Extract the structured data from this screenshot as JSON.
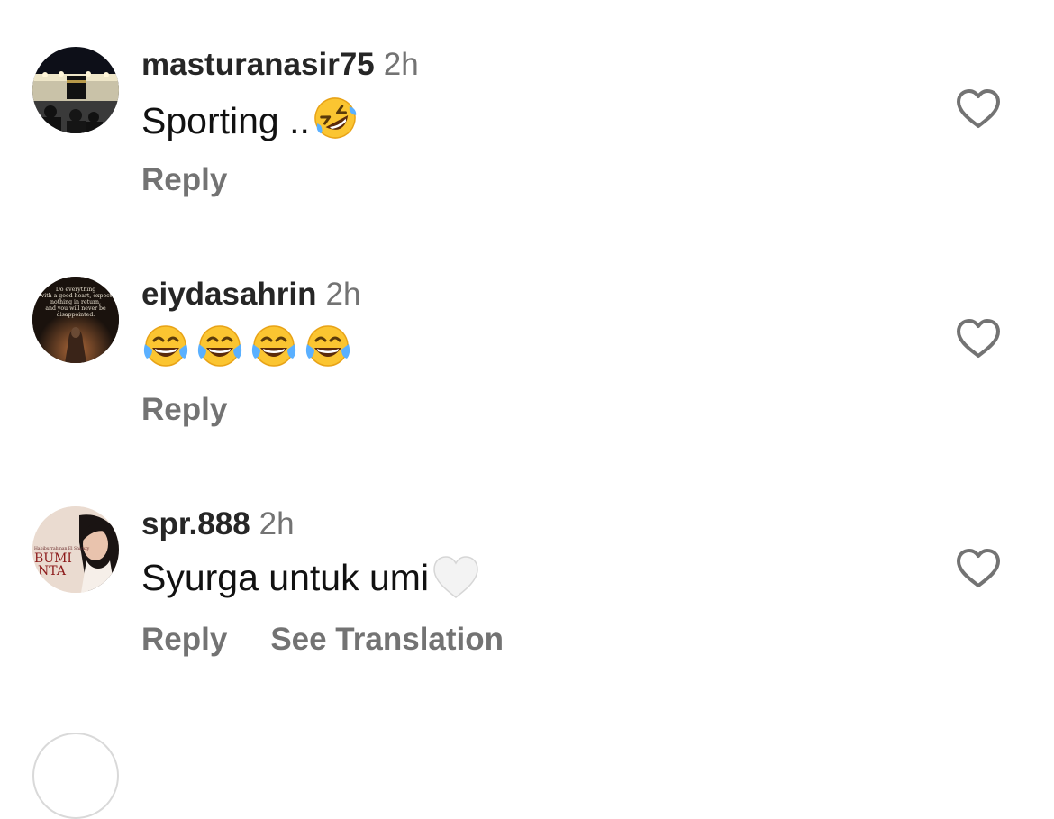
{
  "comments": [
    {
      "username": "masturanasir75",
      "time": "2h",
      "text": "Sporting ..",
      "emoji_icon": "rolling-on-floor-laughing-icon",
      "actions": [
        "Reply"
      ],
      "avatar_icon": "kaaba-night-avatar-icon"
    },
    {
      "username": "eiydasahrin",
      "time": "2h",
      "text": "",
      "emoji_icon": "tears-of-joy-icon",
      "emoji_count": 4,
      "actions": [
        "Reply"
      ],
      "avatar_icon": "quote-poster-avatar-icon",
      "avatar_quote": [
        "Do everything",
        "with a good heart, expect",
        "nothing in return,",
        "and you will never be",
        "disappointed."
      ]
    },
    {
      "username": "spr.888",
      "time": "2h",
      "text": "Syurga untuk umi",
      "emoji_icon": "white-heart-icon",
      "actions": [
        "Reply",
        "See Translation"
      ],
      "avatar_icon": "book-cover-avatar-icon",
      "avatar_text": [
        "Habiburrahman El Shirazy",
        "BUMI",
        "NTA"
      ]
    }
  ],
  "colors": {
    "username": "#262626",
    "meta_gray": "#737373",
    "text": "#111111",
    "like_icon": "#737373"
  }
}
